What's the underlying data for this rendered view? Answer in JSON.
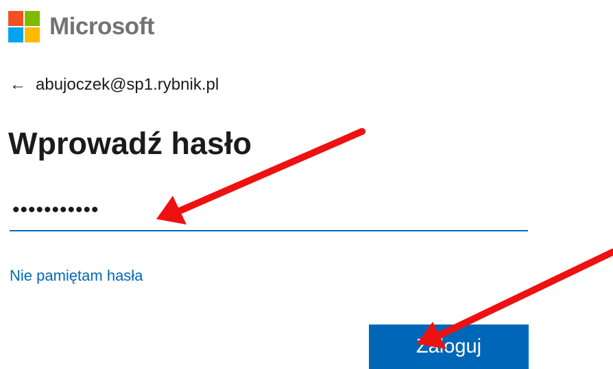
{
  "brand": {
    "name": "Microsoft",
    "logo_colors": [
      "#f25022",
      "#7fba00",
      "#00a4ef",
      "#ffb900"
    ]
  },
  "identity": {
    "back_icon": "left-arrow",
    "email": "abujoczek@sp1.rybnik.pl"
  },
  "form": {
    "title": "Wprowadź hasło",
    "password_value": "•••••••••••",
    "forgot_link": "Nie pamiętam hasła",
    "submit_label": "Zaloguj"
  },
  "colors": {
    "accent": "#0067b8",
    "annotation_arrow": "#ee1111"
  }
}
